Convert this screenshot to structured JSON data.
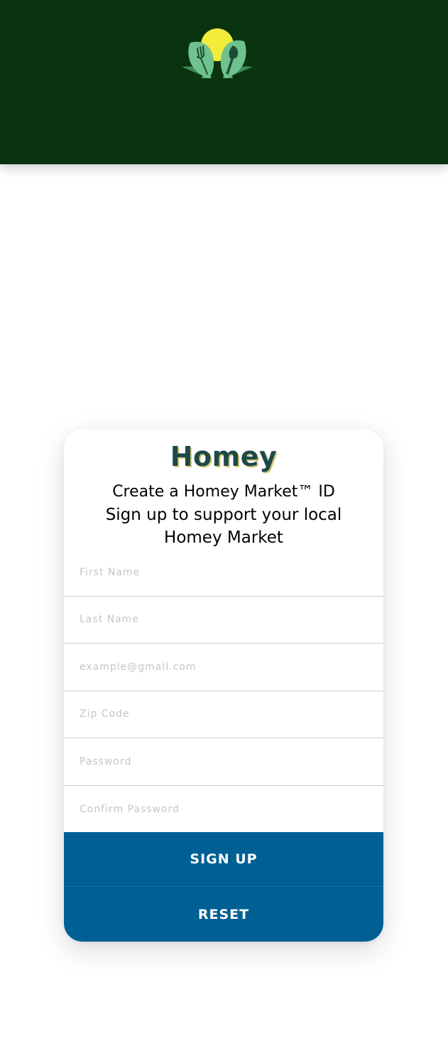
{
  "header": {
    "logo_icon": "homey-market-logo-icon",
    "colors": {
      "background": "#0a340f",
      "sun": "#f2ec3a",
      "leaf": "#6fc28e"
    }
  },
  "card": {
    "brand": "Homey",
    "heading": "Create a Homey Market™ ID",
    "subheading": "Sign up to support your local Homey Market",
    "fields": [
      {
        "name": "first-name",
        "placeholder": "First Name"
      },
      {
        "name": "last-name",
        "placeholder": "Last Name"
      },
      {
        "name": "email",
        "placeholder": "example@gmail.com"
      },
      {
        "name": "zip-code",
        "placeholder": "Zip Code"
      },
      {
        "name": "password",
        "placeholder": "Password"
      },
      {
        "name": "confirm-password",
        "placeholder": "Confirm Password"
      }
    ],
    "signup_label": "SIGN UP",
    "reset_label": "RESET",
    "colors": {
      "button": "#006094",
      "brand_text": "#1c4a4a",
      "brand_shadow": "#d9c97a"
    }
  }
}
